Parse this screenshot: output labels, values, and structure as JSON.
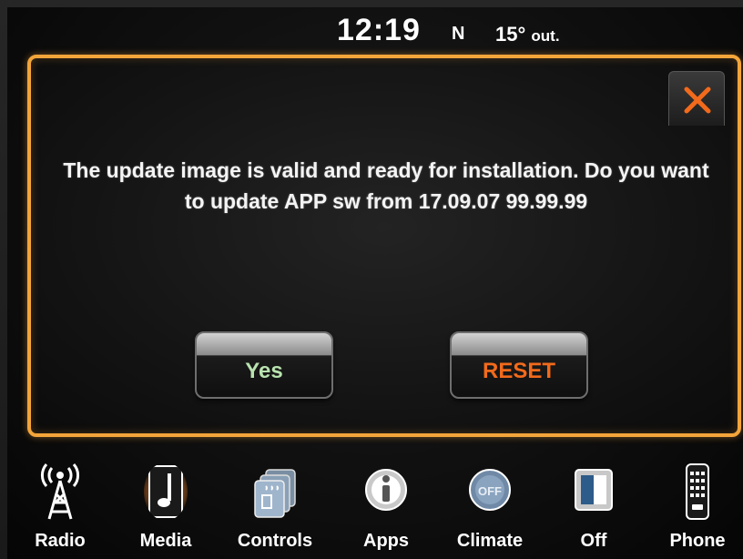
{
  "status_bar": {
    "time": "12:19",
    "compass": "N",
    "temperature": "15°",
    "temperature_suffix": "out."
  },
  "dialog": {
    "message": "The update image is valid and ready for installation. Do you want to update APP sw from 17.09.07 99.99.99",
    "close_icon": "close-x-icon",
    "buttons": {
      "yes_label": "Yes",
      "reset_label": "RESET"
    }
  },
  "nav": {
    "items": [
      {
        "label": "Radio",
        "icon": "radio-tower-icon"
      },
      {
        "label": "Media",
        "icon": "music-note-icon",
        "active": true
      },
      {
        "label": "Controls",
        "icon": "seat-heat-controls-icon"
      },
      {
        "label": "Apps",
        "icon": "apps-icon"
      },
      {
        "label": "Climate",
        "icon": "climate-fan-icon"
      },
      {
        "label": "Off",
        "icon": "screen-off-icon"
      },
      {
        "label": "Phone",
        "icon": "phone-keypad-icon"
      }
    ]
  },
  "colors": {
    "accent_orange": "#f3a53a",
    "reset_text": "#f26a1b",
    "yes_text": "#b9e3b0",
    "text": "#ffffff"
  }
}
